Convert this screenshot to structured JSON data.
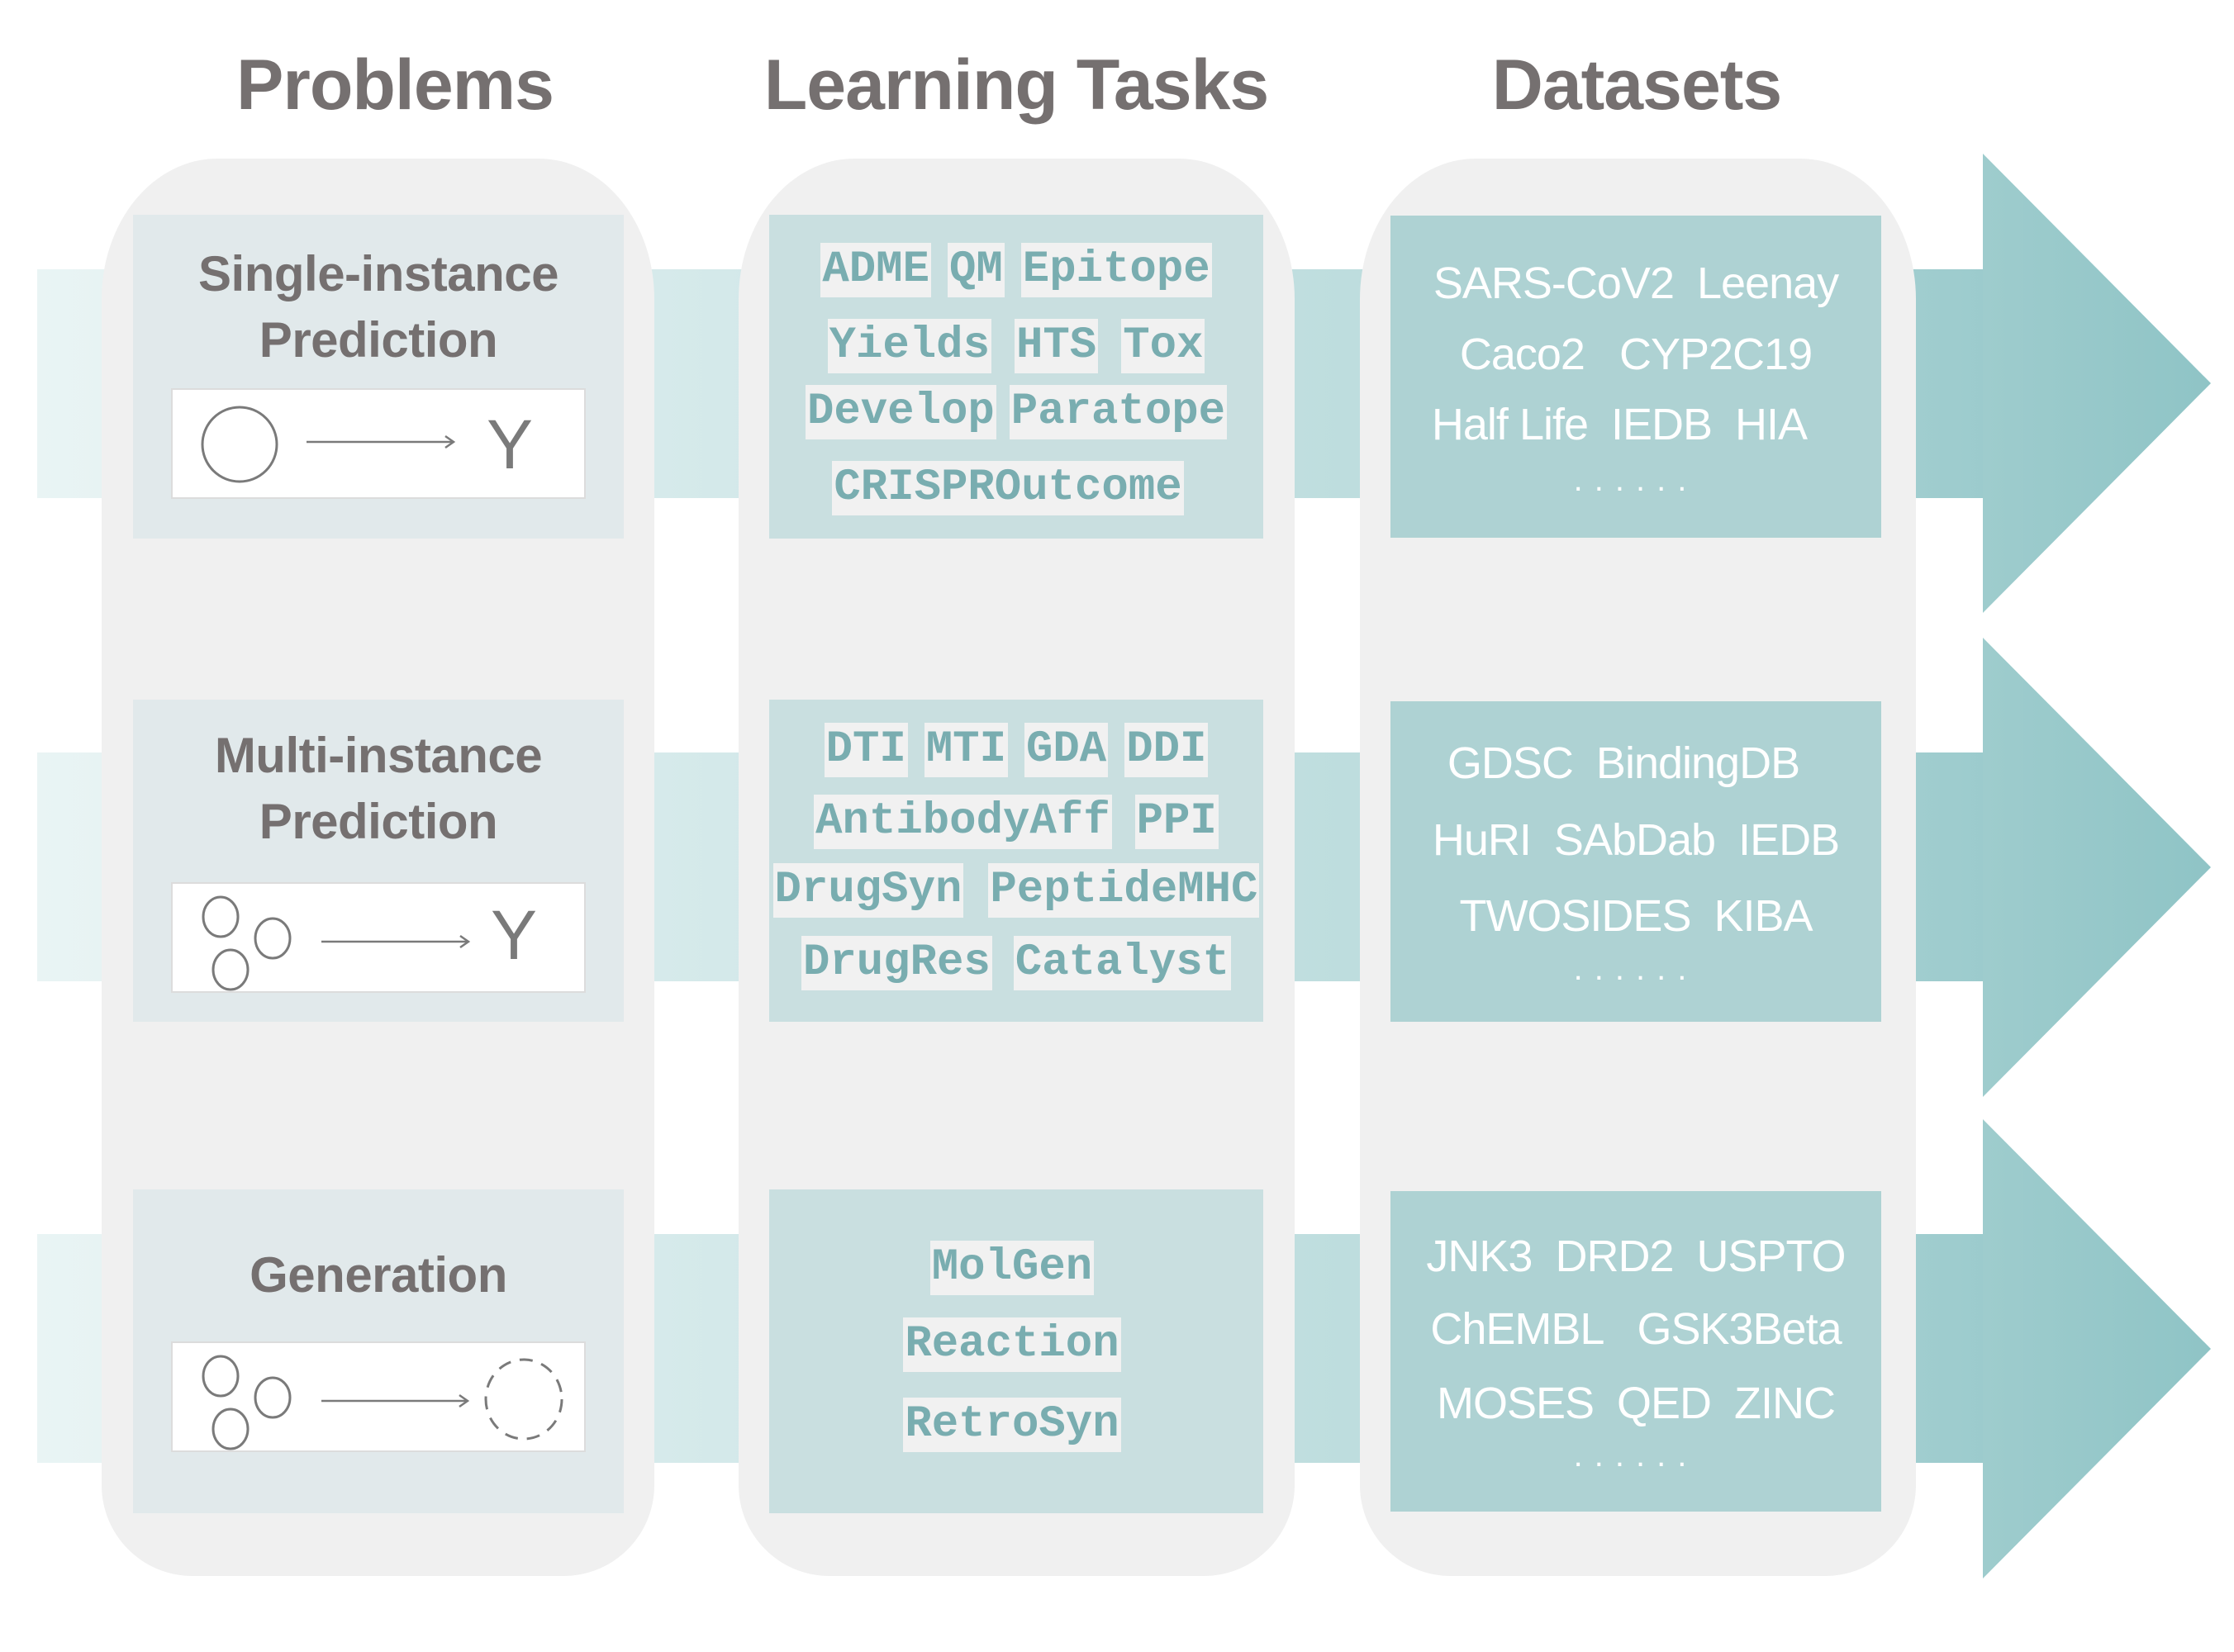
{
  "headers": {
    "problems": "Problems",
    "learning_tasks": "Learning Tasks",
    "datasets": "Datasets"
  },
  "colors": {
    "panel_bg": "#f0f0f0",
    "problem_box_bg": "#e1e9eb",
    "task_box_bg": "#c9dfe0",
    "task_chip_bg": "#f1f1f1",
    "task_chip_text": "#79adb0",
    "dataset_box_bg": "#aed2d3",
    "dataset_text": "#ffffff",
    "header_text": "#757070",
    "arrow": "#93c6c8"
  },
  "rows": [
    {
      "problem": {
        "title_line1": "Single-instance",
        "title_line2": "Prediction",
        "diagram": {
          "inputs": "single-circle",
          "output_label": "Y"
        }
      },
      "tasks": [
        [
          "ADME",
          "QM",
          "Epitope"
        ],
        [
          "Yields",
          "HTS",
          "Tox"
        ],
        [
          "Develop",
          "Paratope"
        ],
        [
          "CRISPROutcome"
        ]
      ],
      "datasets": {
        "lines": [
          "SARS-CoV2  Leenay",
          "Caco2   CYP2C19",
          "Half Life  IEDB  HIA"
        ],
        "ellipsis": "......"
      }
    },
    {
      "problem": {
        "title_line1": "Multi-instance",
        "title_line2": "Prediction",
        "diagram": {
          "inputs": "three-circles",
          "output_label": "Y"
        }
      },
      "tasks": [
        [
          "DTI",
          "MTI",
          "GDA",
          "DDI"
        ],
        [
          "AntibodyAff",
          "PPI"
        ],
        [
          "DrugSyn",
          "PeptideMHC"
        ],
        [
          "DrugRes",
          "Catalyst"
        ]
      ],
      "datasets": {
        "lines": [
          "GDSC  BindingDB",
          "HuRI  SAbDab  IEDB",
          "TWOSIDES  KIBA"
        ],
        "ellipsis": "......"
      }
    },
    {
      "problem": {
        "title_line1": "Generation",
        "title_line2": "",
        "diagram": {
          "inputs": "three-circles",
          "output_label": ""
        }
      },
      "tasks": [
        [
          "MolGen"
        ],
        [
          "Reaction"
        ],
        [
          "RetroSyn"
        ]
      ],
      "datasets": {
        "lines": [
          "JNK3  DRD2  USPTO",
          "ChEMBL   GSK3Beta",
          "MOSES  QED  ZINC"
        ],
        "ellipsis": "......"
      }
    }
  ]
}
